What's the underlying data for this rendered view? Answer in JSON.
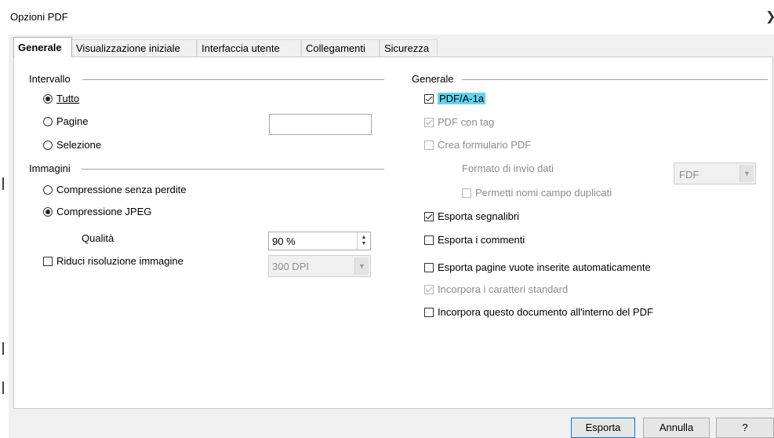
{
  "window": {
    "title": "Opzioni PDF",
    "close_icon": "close-icon"
  },
  "tabs": [
    {
      "label": "Generale"
    },
    {
      "label": "Visualizzazione iniziale"
    },
    {
      "label": "Interfaccia utente"
    },
    {
      "label": "Collegamenti"
    },
    {
      "label": "Sicurezza"
    }
  ],
  "intervallo": {
    "title": "Intervallo",
    "tutto": "Tutto",
    "pagine": "Pagine",
    "pagine_value": "",
    "selezione": "Selezione"
  },
  "immagini": {
    "title": "Immagini",
    "senza_perdite": "Compressione senza perdite",
    "jpeg": "Compressione JPEG",
    "qualita_label": "Qualità",
    "qualita_value": "90 %",
    "riduci": "Riduci risoluzione immagine",
    "dpi_value": "300 DPI"
  },
  "generale": {
    "title": "Generale",
    "pdfa": "PDF/A-1a",
    "pdf_tag": "PDF con tag",
    "crea_form": "Crea formulario PDF",
    "formato_label": "Formato di invio dati",
    "formato_value": "FDF",
    "permetti": "Permetti nomi campo duplicati",
    "segnalibri": "Esporta segnalibri",
    "commenti": "Esporta i commenti",
    "pagine_vuote": "Esporta pagine vuote inserite automaticamente",
    "incorpora_caratteri": "Incorpora i caratteri standard",
    "incorpora_doc": "Incorpora questo documento all'interno del PDF"
  },
  "buttons": {
    "esporta": "Esporta",
    "annulla": "Annulla",
    "help": "?"
  }
}
